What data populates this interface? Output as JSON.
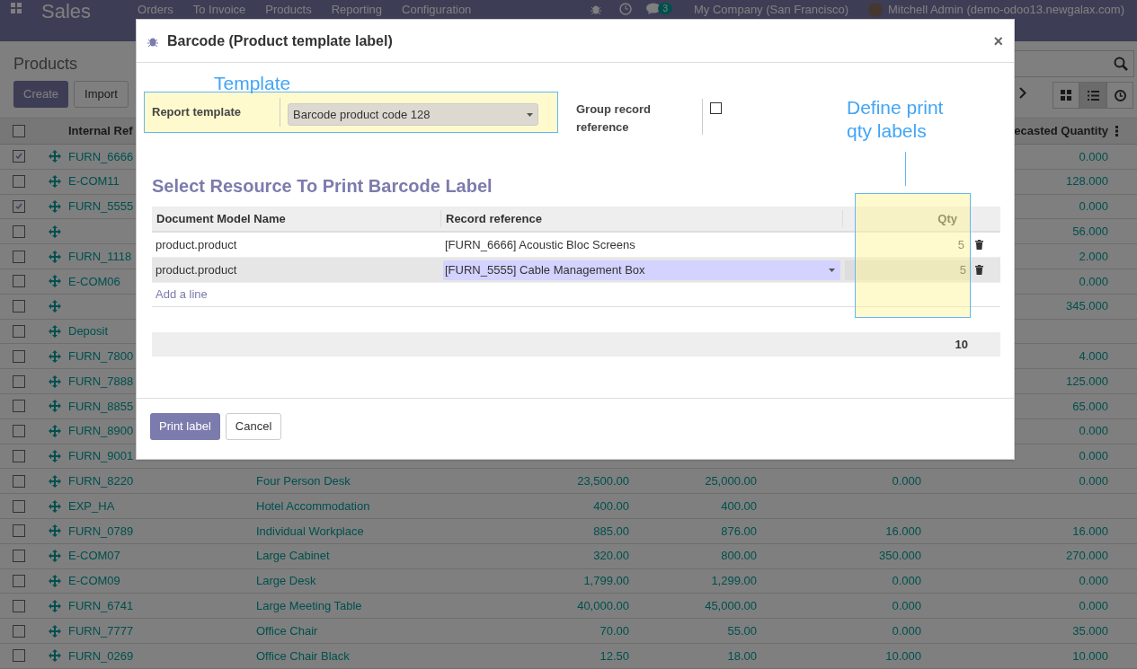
{
  "navbar": {
    "app_name": "Sales",
    "menu": [
      "Orders",
      "To Invoice",
      "Products",
      "Reporting",
      "Configuration"
    ],
    "message_count": "3",
    "company": "My Company (San Francisco)",
    "user": "Mitchell Admin (demo-odoo13.newgalax.com)"
  },
  "control_panel": {
    "breadcrumb": "Products",
    "buttons": [
      "Create",
      "Import"
    ],
    "views": [
      {
        "kind": "kanban",
        "selected": false
      },
      {
        "kind": "list",
        "selected": true
      },
      {
        "kind": "activity",
        "selected": false
      }
    ]
  },
  "list": {
    "select_all_checked": false,
    "columns": [
      "Internal Ref",
      "ecasted Quantity"
    ],
    "rows": [
      {
        "checked": true,
        "ref": "FURN_6666",
        "forecast": "0.000"
      },
      {
        "checked": false,
        "ref": "E-COM11",
        "forecast": "128.000"
      },
      {
        "checked": true,
        "ref": "FURN_5555",
        "forecast": "0.000"
      },
      {
        "checked": false,
        "forecast": "56.000"
      },
      {
        "checked": false,
        "ref": "FURN_1118",
        "forecast": "2.000"
      },
      {
        "checked": false,
        "ref": "E-COM06",
        "forecast": "0.000"
      },
      {
        "checked": false,
        "forecast": "345.000"
      },
      {
        "checked": false,
        "ref": "Deposit"
      },
      {
        "checked": false,
        "ref": "FURN_7800",
        "forecast": "4.000"
      },
      {
        "checked": false,
        "ref": "FURN_7888",
        "forecast": "125.000"
      },
      {
        "checked": false,
        "ref": "FURN_8855",
        "forecast": "65.000"
      },
      {
        "checked": false,
        "ref": "FURN_8900",
        "forecast": "0.000"
      },
      {
        "checked": false,
        "ref": "FURN_9001",
        "forecast": "0.000"
      },
      {
        "checked": false,
        "ref": "FURN_8220",
        "name": "Four Person Desk",
        "sales_price": "23,500.00",
        "cost": "25,000.00",
        "on_hand": "0.000",
        "forecast": "0.000"
      },
      {
        "checked": false,
        "ref": "EXP_HA",
        "name": "Hotel Accommodation",
        "sales_price": "400.00",
        "cost": "400.00"
      },
      {
        "checked": false,
        "ref": "FURN_0789",
        "name": "Individual Workplace",
        "sales_price": "885.00",
        "cost": "876.00",
        "on_hand": "16.000",
        "forecast": "16.000"
      },
      {
        "checked": false,
        "ref": "E-COM07",
        "name": "Large Cabinet",
        "sales_price": "320.00",
        "cost": "800.00",
        "on_hand": "350.000",
        "forecast": "270.000"
      },
      {
        "checked": false,
        "ref": "E-COM09",
        "name": "Large Desk",
        "sales_price": "1,799.00",
        "cost": "1,299.00",
        "on_hand": "0.000",
        "forecast": "0.000"
      },
      {
        "checked": false,
        "ref": "FURN_6741",
        "name": "Large Meeting Table",
        "sales_price": "40,000.00",
        "cost": "45,000.00",
        "on_hand": "0.000",
        "forecast": "0.000"
      },
      {
        "checked": false,
        "ref": "FURN_7777",
        "name": "Office Chair",
        "sales_price": "70.00",
        "cost": "55.00",
        "on_hand": "0.000",
        "forecast": "35.000"
      },
      {
        "checked": false,
        "ref": "FURN_0269",
        "name": "Office Chair Black",
        "sales_price": "12.50",
        "cost": "18.00",
        "on_hand": "10.000",
        "forecast": "10.000"
      }
    ]
  },
  "modal": {
    "title": "Barcode (Product template label)",
    "close": "×",
    "fields": [
      {
        "kind": "select",
        "label": "Report template",
        "value": "Barcode product code 128"
      },
      {
        "kind": "checkbox",
        "label": "Group record reference",
        "checked": false
      }
    ],
    "section_title": "Select Resource To Print Barcode Label",
    "table": {
      "columns": [
        "Document Model Name",
        "Record reference",
        "Qty"
      ],
      "rows": [
        {
          "model": "product.product",
          "record": "[FURN_6666] Acoustic Bloc Screens",
          "qty": "5",
          "editing": false
        },
        {
          "model": "product.product",
          "record": "[FURN_5555] Cable Management Box",
          "qty": "5",
          "editing": true
        }
      ],
      "add_line": "Add a line",
      "total": "10"
    },
    "buttons": [
      {
        "label": "Print label",
        "primary": true
      },
      {
        "label": "Cancel",
        "primary": false
      }
    ],
    "annotations": [
      "Template",
      "Define print qty labels"
    ]
  }
}
